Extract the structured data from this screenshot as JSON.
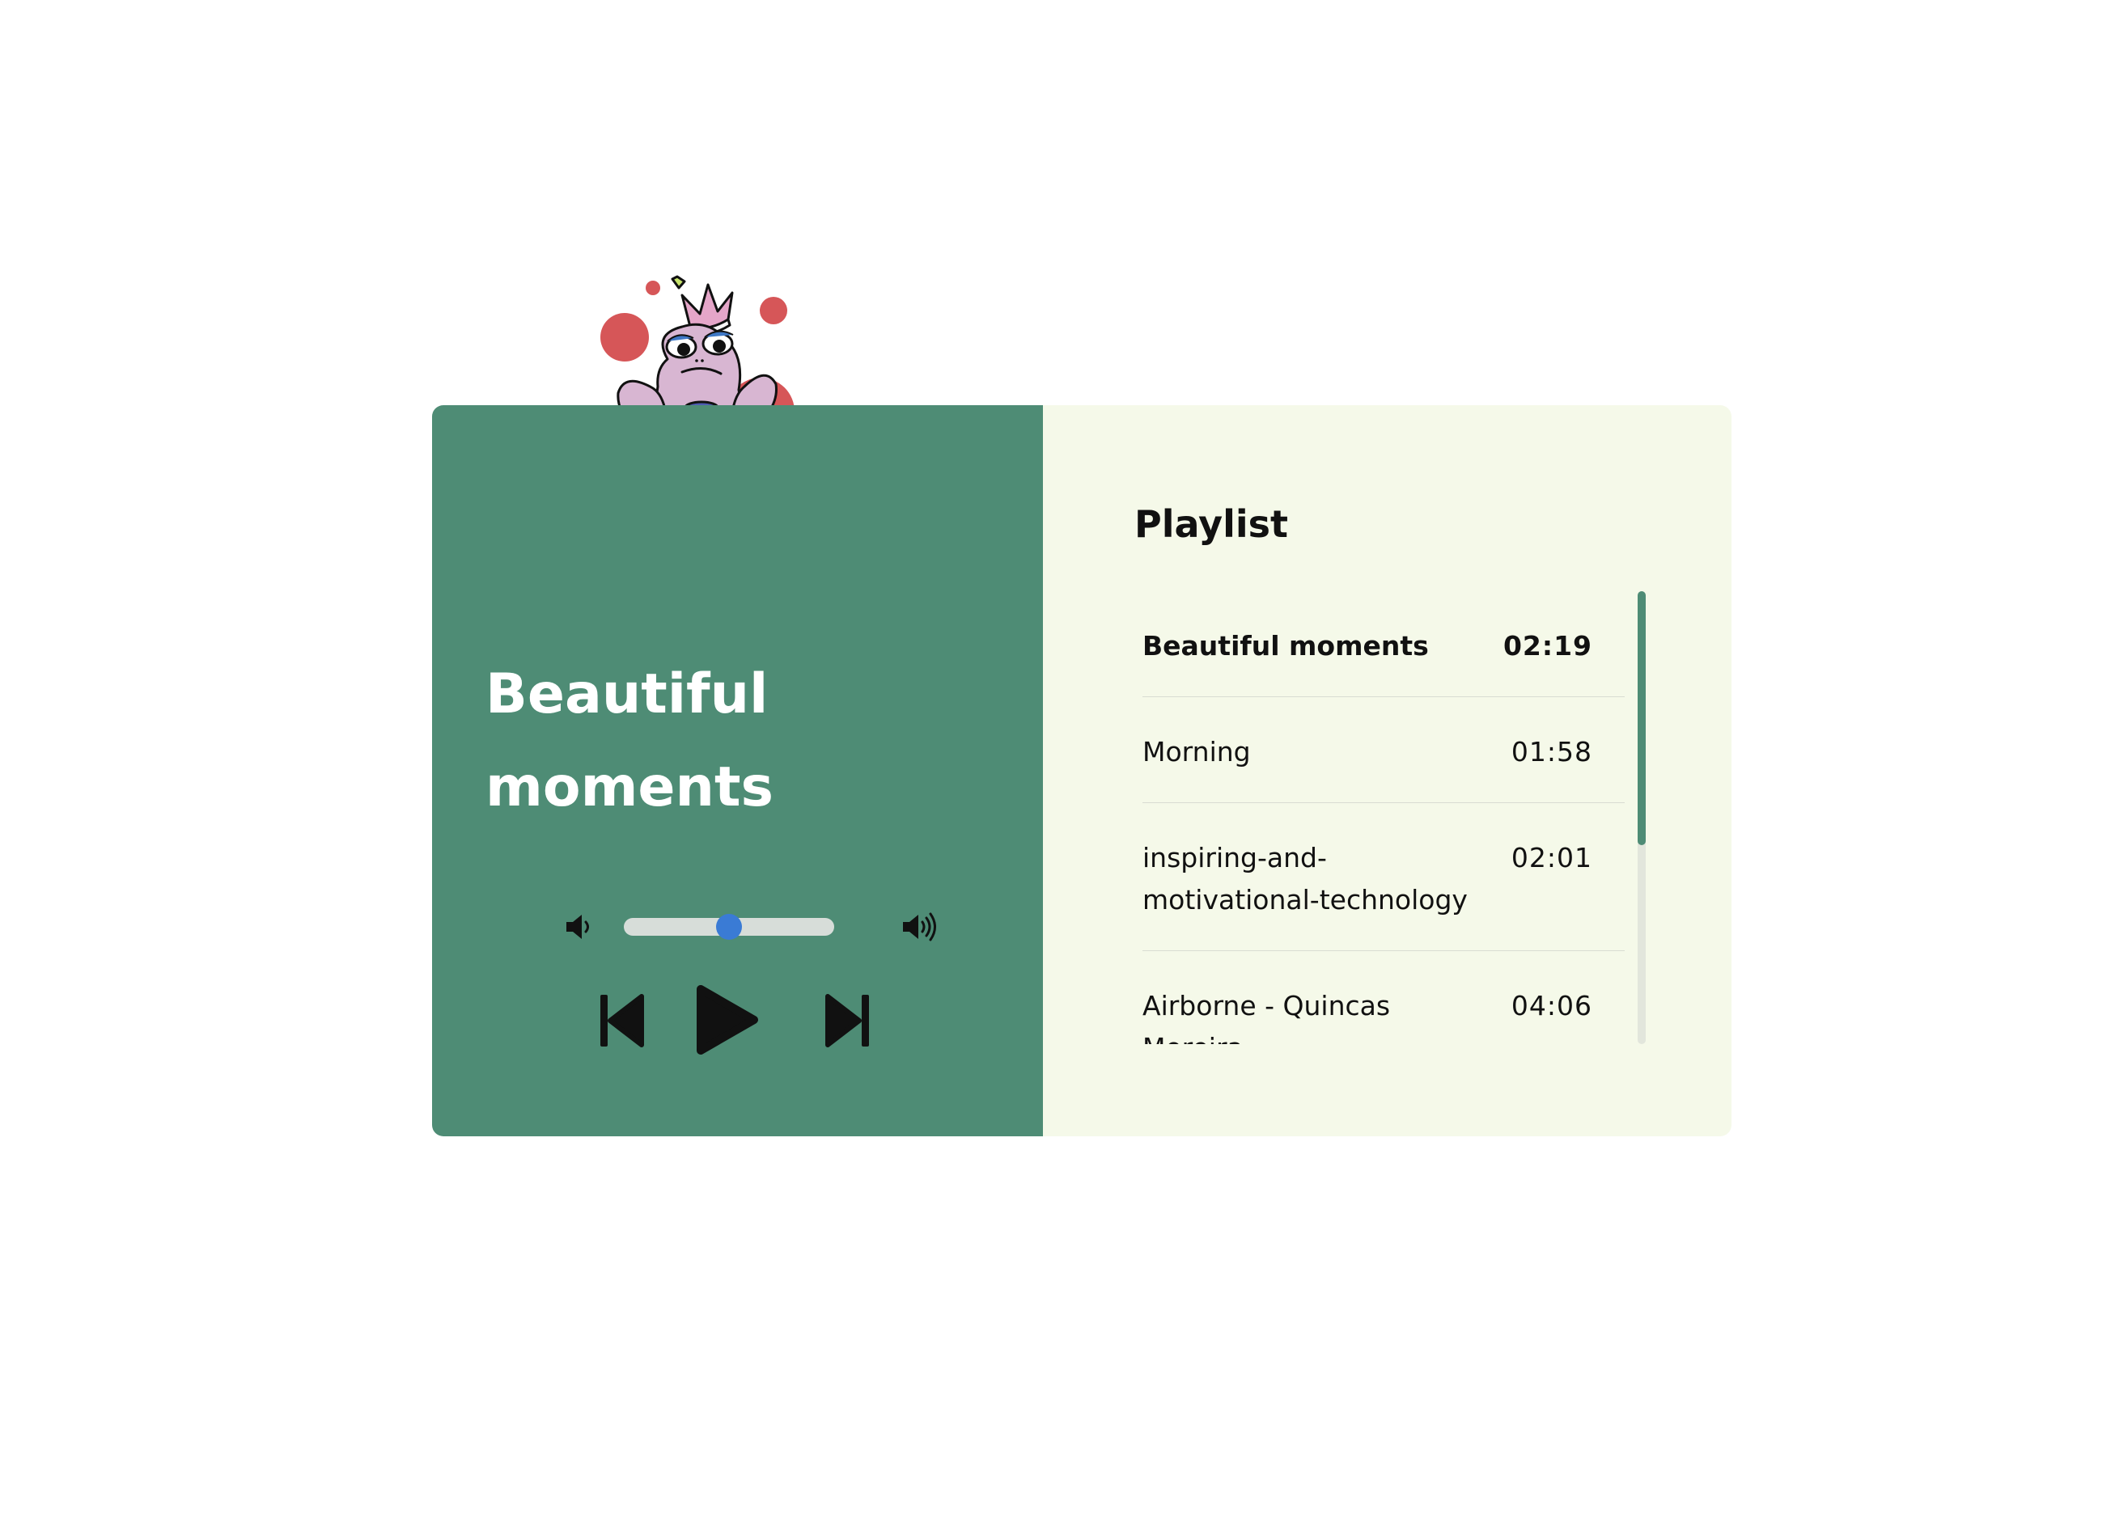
{
  "colors": {
    "player_bg": "#4e8c75",
    "playlist_bg": "#f5f9e9",
    "accent_dots": "#d65658",
    "slider_thumb": "#3a7bd5",
    "frog_body": "#d8b6d2"
  },
  "now_playing": {
    "title": "Beautiful moments",
    "volume_level": 0.5
  },
  "controls": {
    "volume_down_icon": "volume-low-icon",
    "volume_up_icon": "volume-high-icon",
    "previous_icon": "skip-previous-icon",
    "play_icon": "play-icon",
    "next_icon": "skip-next-icon"
  },
  "playlist": {
    "heading": "Playlist",
    "tracks": [
      {
        "name": "Beautiful moments",
        "duration": "02:19",
        "active": true
      },
      {
        "name": "Morning",
        "duration": "01:58",
        "active": false
      },
      {
        "name": "inspiring-and-motivational-technology",
        "duration": "02:01",
        "active": false
      },
      {
        "name": "Airborne - Quincas Moreira",
        "duration": "04:06",
        "active": false
      }
    ],
    "scroll_position": 0
  }
}
